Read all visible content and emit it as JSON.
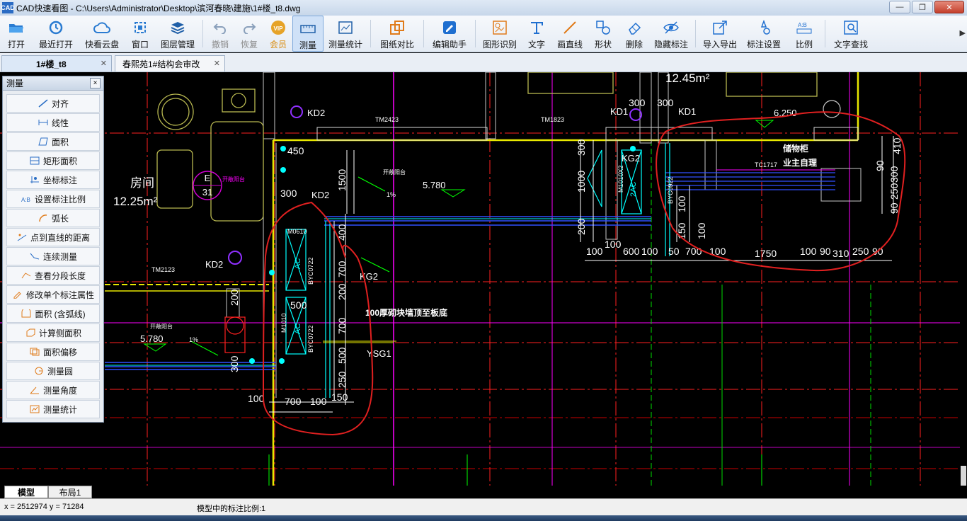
{
  "window": {
    "title": "CAD快速看图 - C:\\Users\\Administrator\\Desktop\\滨河春晓\\建施\\1#楼_t8.dwg",
    "logo": "CAD",
    "controls": [
      "—",
      "❐",
      "✕"
    ]
  },
  "toolbar": {
    "buttons": [
      {
        "label": "打开",
        "icon": "folder-open-icon"
      },
      {
        "label": "最近打开",
        "icon": "history-icon"
      },
      {
        "label": "快看云盘",
        "icon": "cloud-icon"
      },
      {
        "label": "窗口",
        "icon": "window-icon"
      },
      {
        "label": "图层管理",
        "icon": "layers-icon"
      },
      {
        "label": "撤销",
        "icon": "undo-icon"
      },
      {
        "label": "恢复",
        "icon": "redo-icon"
      },
      {
        "label": "会员",
        "icon": "vip-icon"
      },
      {
        "label": "测量",
        "icon": "ruler-icon"
      },
      {
        "label": "测量统计",
        "icon": "measure-stats-icon"
      },
      {
        "label": "图纸对比",
        "icon": "compare-icon"
      },
      {
        "label": "编辑助手",
        "icon": "edit-assistant-icon"
      },
      {
        "label": "图形识别",
        "icon": "shape-recognize-icon"
      },
      {
        "label": "文字",
        "icon": "text-icon"
      },
      {
        "label": "画直线",
        "icon": "line-icon"
      },
      {
        "label": "形状",
        "icon": "shape-icon"
      },
      {
        "label": "删除",
        "icon": "eraser-icon"
      },
      {
        "label": "隐藏标注",
        "icon": "eye-hide-icon"
      },
      {
        "label": "导入导出",
        "icon": "import-export-icon"
      },
      {
        "label": "标注设置",
        "icon": "annotation-settings-icon"
      },
      {
        "label": "比例",
        "icon": "scale-icon"
      },
      {
        "label": "文字查找",
        "icon": "text-search-icon"
      }
    ],
    "more": "▶"
  },
  "tabs": [
    {
      "label": "1#楼_t8",
      "close": "✕"
    },
    {
      "label": "春熙苑1#结构会审改",
      "close": "✕"
    }
  ],
  "measure_panel": {
    "title": "测量",
    "close": "×",
    "items": [
      {
        "label": "对齐",
        "icon": "align-measure-icon"
      },
      {
        "label": "线性",
        "icon": "linear-measure-icon"
      },
      {
        "label": "面积",
        "icon": "area-icon"
      },
      {
        "label": "矩形面积",
        "icon": "rect-area-icon"
      },
      {
        "label": "坐标标注",
        "icon": "coordinate-icon"
      },
      {
        "label": "设置标注比例",
        "icon": "scale-set-icon"
      },
      {
        "label": "弧长",
        "icon": "arc-length-icon"
      },
      {
        "label": "点到直线的距离",
        "icon": "point-line-distance-icon"
      },
      {
        "label": "连续测量",
        "icon": "continuous-measure-icon"
      },
      {
        "label": "查看分段长度",
        "icon": "segment-length-icon"
      },
      {
        "label": "修改单个标注属性",
        "icon": "edit-annotation-icon"
      },
      {
        "label": "面积 (含弧线)",
        "icon": "arc-area-icon"
      },
      {
        "label": "计算侧面积",
        "icon": "side-area-icon"
      },
      {
        "label": "面积偏移",
        "icon": "area-offset-icon"
      },
      {
        "label": "测量圆",
        "icon": "circle-measure-icon"
      },
      {
        "label": "测量角度",
        "icon": "angle-measure-icon"
      },
      {
        "label": "测量统计",
        "icon": "stats-icon"
      }
    ]
  },
  "drawing": {
    "room_name": "房间",
    "room_area": "12.25m²",
    "area_top": "12.45m²",
    "elev_left": "5.780",
    "elev_mid": "5.780",
    "elev_right": "6.250",
    "slope_1": "1%",
    "slope_2": "1%",
    "label_kd2_a": "KD2",
    "label_kd2_b": "KD2",
    "label_kd2_c": "KD2",
    "label_kd1_a": "KD1",
    "label_kd1_b": "KD1",
    "label_kg2_a": "KG2",
    "label_kg2_b": "KG2",
    "label_ysg1": "YSG1",
    "tm2423": "TM2423",
    "tm1823": "TM1823",
    "tm2123": "TM2123",
    "m0610": "M0610",
    "m1010": "M1010",
    "m1010x2": "M1010X2",
    "byc0722_a": "BYC0722",
    "byc0722_b": "BYC0722",
    "byc0922": "BYC0922",
    "ac_a": "AC",
    "ac_b": "AC",
    "ac_2": "2AC",
    "wall_note": "100厚砌块墙顶至板底",
    "cabinet": "储物柜",
    "tc1717": "TC1717",
    "self_manage": "业主自理",
    "balcony_a": "开敞阳台",
    "balcony_b": "开敞阳台",
    "balcony_c": "开敞阳台",
    "axis_e": "E",
    "axis_31": "31",
    "dims": {
      "d450": "450",
      "d1500": "1500",
      "d300a": "300",
      "d300b": "300",
      "d300c": "300",
      "d400": "400",
      "d700a": "700",
      "d200a": "200",
      "d700b": "700",
      "d500a": "500",
      "d500b": "500",
      "d250": "250",
      "d200b": "200",
      "d300d": "300",
      "d100a": "100",
      "d700c": "700",
      "d100b": "100",
      "d150": "150",
      "d1000": "1000",
      "d200c": "200",
      "d100c": "100",
      "d100d": "100",
      "d600": "600",
      "d100e": "100",
      "d50": "50",
      "d700d": "700",
      "d100f": "100",
      "d1750": "1750",
      "d100g": "100",
      "d90a": "90",
      "d310": "310",
      "d250b": "250",
      "d90b": "90",
      "d150b": "150",
      "d100h": "100",
      "d100i": "100",
      "d300e": "300",
      "d410": "410",
      "d90c": "90",
      "d300f": "300",
      "d250c": "250",
      "d90d": "90"
    }
  },
  "layout_tabs": [
    "模型",
    "布局1"
  ],
  "status": {
    "coords": "x = 2512974  y = 71284",
    "scale": "模型中的标注比例:1"
  },
  "colors": {
    "wall_yellow": "#e8e800",
    "dim_white": "#ffffff",
    "axis_red": "#ff0000",
    "magenta": "#ff00ff",
    "cyan": "#00ffff",
    "green": "#00ff00",
    "annotation_red": "#e02020"
  }
}
